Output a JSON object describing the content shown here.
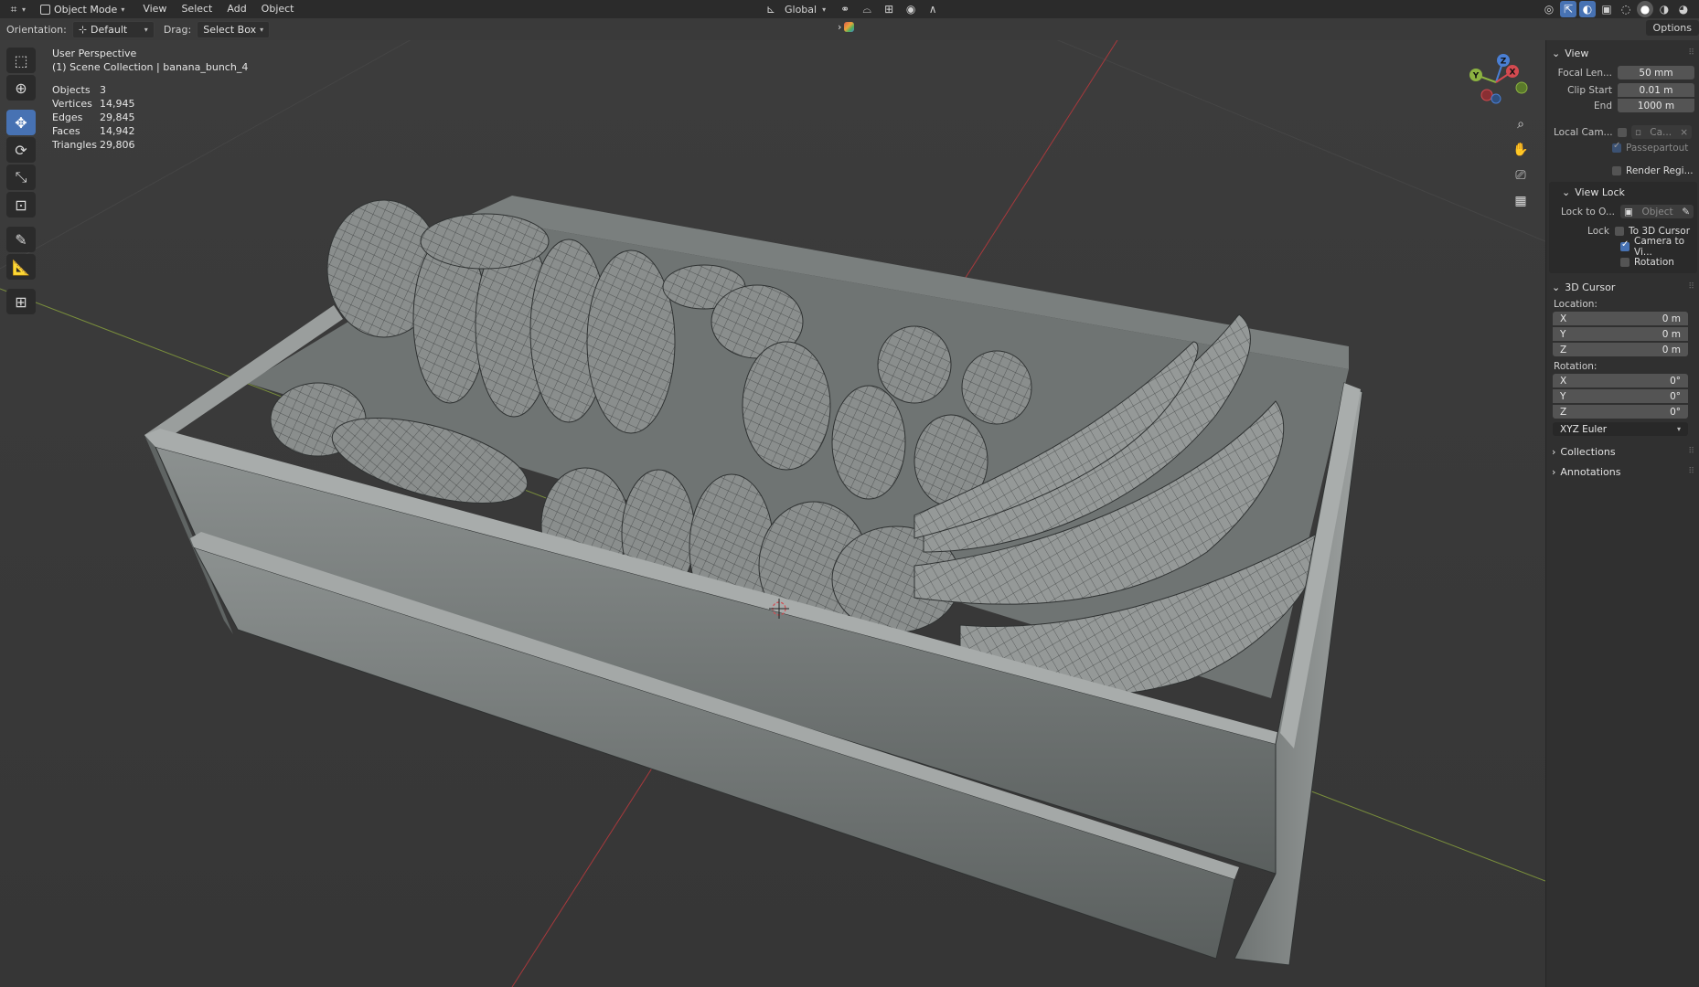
{
  "topbar": {
    "mode": "Object Mode",
    "menus": [
      "View",
      "Select",
      "Add",
      "Object"
    ],
    "transform_orientation": "Global"
  },
  "header2": {
    "orientation_label": "Orientation:",
    "orientation_value": "Default",
    "drag_label": "Drag:",
    "drag_value": "Select Box",
    "options_label": "Options"
  },
  "overlay": {
    "view_name": "User Perspective",
    "collection": "(1) Scene Collection | banana_bunch_4",
    "stats": [
      {
        "label": "Objects",
        "value": "3"
      },
      {
        "label": "Vertices",
        "value": "14,945"
      },
      {
        "label": "Edges",
        "value": "29,845"
      },
      {
        "label": "Faces",
        "value": "14,942"
      },
      {
        "label": "Triangles",
        "value": "29,806"
      }
    ]
  },
  "gizmo": {
    "x": "X",
    "y": "Y",
    "z": "Z"
  },
  "sidebar": {
    "view": {
      "title": "View",
      "focal_length_label": "Focal Len...",
      "focal_length": "50 mm",
      "clip_start_label": "Clip Start",
      "clip_start": "0.01 m",
      "clip_end_label": "End",
      "clip_end": "1000 m",
      "local_camera_label": "Local Cam...",
      "local_camera_value": "Ca...",
      "passepartout": "Passepartout",
      "render_region": "Render Regi..."
    },
    "view_lock": {
      "title": "View Lock",
      "lock_to_object_label": "Lock to O...",
      "lock_to_object_placeholder": "Object",
      "lock_label": "Lock",
      "to_3d_cursor": "To 3D Cursor",
      "camera_to_view": "Camera to Vi...",
      "rotation": "Rotation"
    },
    "cursor": {
      "title": "3D Cursor",
      "location_label": "Location:",
      "location": [
        {
          "axis": "X",
          "value": "0 m"
        },
        {
          "axis": "Y",
          "value": "0 m"
        },
        {
          "axis": "Z",
          "value": "0 m"
        }
      ],
      "rotation_label": "Rotation:",
      "rotation": [
        {
          "axis": "X",
          "value": "0°"
        },
        {
          "axis": "Y",
          "value": "0°"
        },
        {
          "axis": "Z",
          "value": "0°"
        }
      ],
      "rotation_mode": "XYZ Euler"
    },
    "collections_title": "Collections",
    "annotations_title": "Annotations"
  },
  "colors": {
    "active_tool": "#4772b3",
    "axis_x": "#d44a50",
    "axis_y": "#8cb341",
    "axis_z": "#4a7fd4"
  }
}
